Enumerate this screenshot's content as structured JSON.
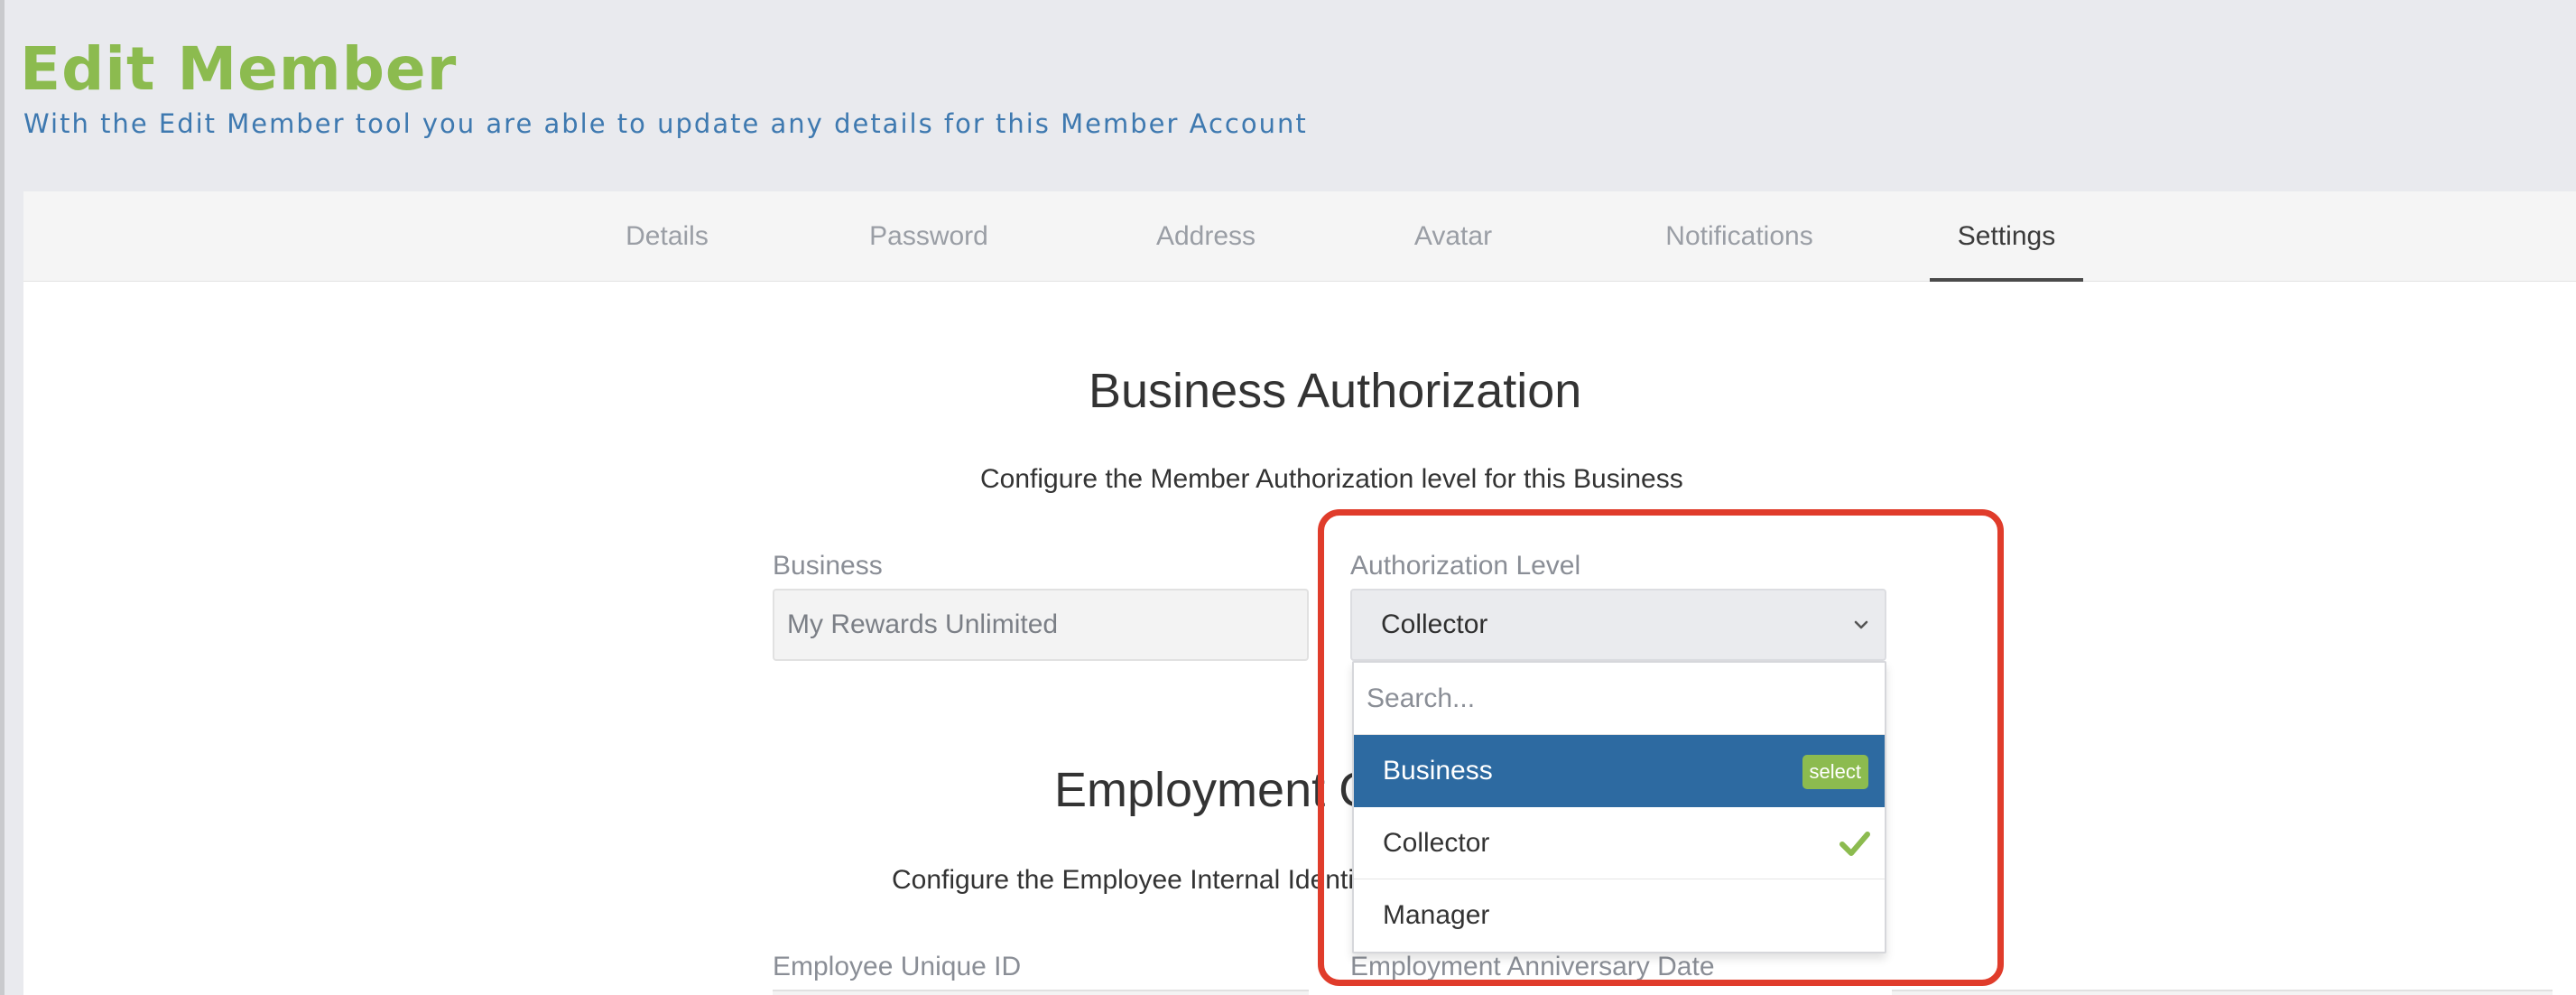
{
  "header": {
    "title": "Edit Member",
    "subtitle": "With the Edit Member tool you are able to update any details for this Member Account"
  },
  "tabs": [
    {
      "label": "Details",
      "active": false
    },
    {
      "label": "Password",
      "active": false
    },
    {
      "label": "Address",
      "active": false
    },
    {
      "label": "Avatar",
      "active": false
    },
    {
      "label": "Notifications",
      "active": false
    },
    {
      "label": "Settings",
      "active": true
    }
  ],
  "business_authorization": {
    "title": "Business Authorization",
    "description": "Configure the Member Authorization level for this Business",
    "business_label": "Business",
    "business_value": "My Rewards Unlimited",
    "auth_label": "Authorization Level",
    "auth_value": "Collector",
    "dropdown": {
      "search_placeholder": "Search...",
      "options": [
        {
          "label": "Business",
          "highlighted": true,
          "badge": "select"
        },
        {
          "label": "Collector",
          "selected": true
        },
        {
          "label": "Manager"
        }
      ]
    }
  },
  "employment": {
    "title": "Employment C",
    "description": "Configure the Employee Internal Identi",
    "uid_label": "Employee Unique ID",
    "anniversary_label": "Employment Anniversary Date"
  },
  "colors": {
    "brand_green": "#8cbb4f",
    "link_blue": "#3e79b0",
    "highlight_blue": "#2d6aa1",
    "annotation_red": "#e03c2b"
  },
  "icons": {
    "select_chevron": "chevron-down-icon",
    "selected_check": "check-icon"
  }
}
